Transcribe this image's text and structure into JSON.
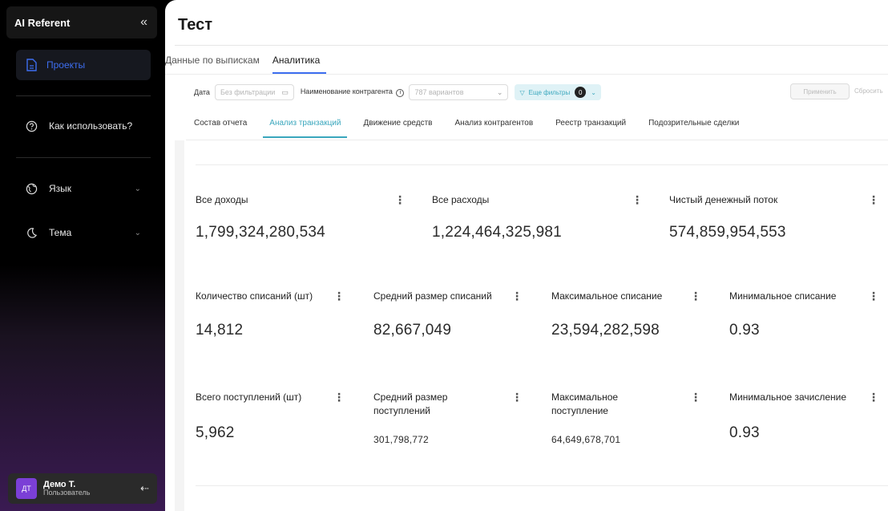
{
  "sidebar": {
    "app_title": "AI Referent",
    "collapse_icon": "double-chevron-left-icon",
    "projects": "Проекты",
    "how_to": "Как использовать?",
    "language": "Язык",
    "theme": "Тема",
    "user": {
      "initials": "ДТ",
      "name": "Демо Т.",
      "role": "Пользователь"
    }
  },
  "page": {
    "title": "Тест"
  },
  "tabs": [
    "Данные по выпискам",
    "Аналитика"
  ],
  "filters": {
    "date_label": "Дата",
    "date_placeholder": "Без фильтрации",
    "counterparty_label": "Наименование контрагента",
    "counterparty_value": "787 вариантов",
    "more_filters": "Еще фильтры",
    "more_filters_count": "0",
    "apply": "Применить",
    "reset": "Сбросить"
  },
  "subtabs": [
    "Состав отчета",
    "Анализ транзакций",
    "Движение средств",
    "Анализ контрагентов",
    "Реестр транзакций",
    "Подозрительные сделки"
  ],
  "metrics": {
    "all_income": {
      "label": "Все доходы",
      "value": "1,799,324,280,534"
    },
    "all_expenses": {
      "label": "Все расходы",
      "value": "1,224,464,325,981"
    },
    "net_cash_flow": {
      "label": "Чистый денежный поток",
      "value": "574,859,954,553"
    },
    "debit_count": {
      "label": "Количество списаний (шт)",
      "value": "14,812"
    },
    "avg_debit": {
      "label": "Средний размер списаний",
      "value": "82,667,049"
    },
    "max_debit": {
      "label": "Максимальное списание",
      "value": "23,594,282,598"
    },
    "min_debit": {
      "label": "Минимальное списание",
      "value": "0.93"
    },
    "credit_count": {
      "label": "Всего поступлений (шт)",
      "value": "5,962"
    },
    "avg_credit": {
      "label": "Средний размер поступлений",
      "value": "301,798,772"
    },
    "max_credit": {
      "label": "Максимальное поступление",
      "value": "64,649,678,701"
    },
    "min_credit": {
      "label": "Минимальное зачисление",
      "value": "0.93"
    }
  },
  "colors": {
    "accent_blue": "#3d6ef0",
    "accent_teal": "#3aa7bd",
    "avatar": "#7b3fd6"
  }
}
